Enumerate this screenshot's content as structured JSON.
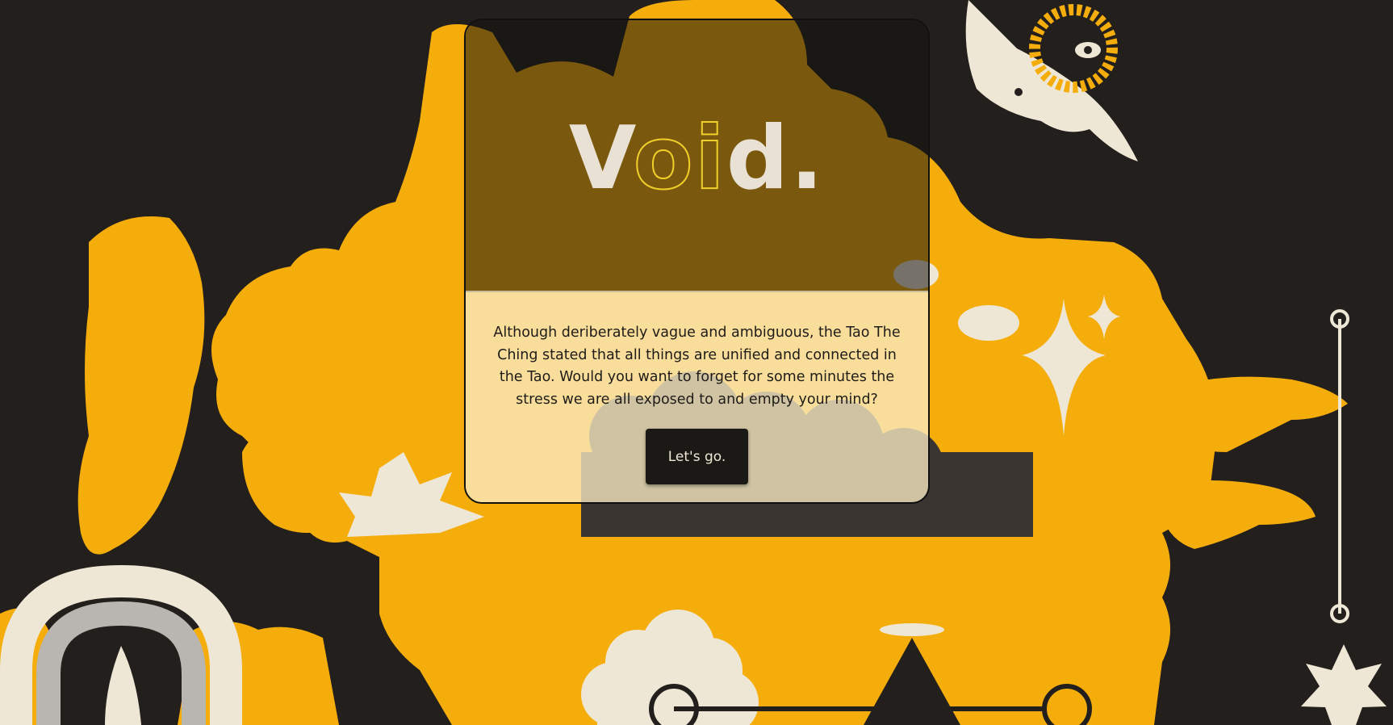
{
  "hero": {
    "title_part1": "V",
    "title_part2": "oi",
    "title_part3": "d."
  },
  "intro": {
    "text": "Although deriberately vague and ambiguous, the Tao The Ching stated that all things are unified and connected in the Tao. Would you want to forget for some minutes the stress we are all exposed to and empty your mind?",
    "cta_label": "Let's go."
  },
  "colors": {
    "background": "#231f1c",
    "accent_yellow": "#f5ad0c",
    "cream": "#efe7d6",
    "title_outline": "#f0cf2a",
    "button": "#1b1916"
  },
  "illustration": {
    "icons": [
      "sun-icon",
      "eye-icon",
      "cloud-icon",
      "sparkle-icon",
      "wing-icon",
      "flame-icon",
      "rainbow-icon",
      "mountain-icon",
      "star-icon",
      "hand-icon"
    ]
  }
}
